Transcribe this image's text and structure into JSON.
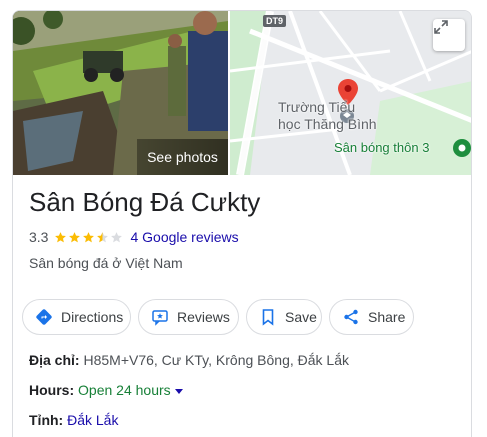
{
  "photo": {
    "see_photos_label": "See photos"
  },
  "map": {
    "road_label": "DT9",
    "school_label_line1": "Trường Tiểu",
    "school_label_line2": "học Thăng Bình",
    "field_label": "Sân bóng thôn 3"
  },
  "place": {
    "title": "Sân Bóng Đá Cưkty",
    "rating": "3.3",
    "stars_filled": 3.3,
    "stars_total": 5,
    "reviews_link": "4 Google reviews",
    "category": "Sân bóng đá ở Việt Nam"
  },
  "actions": {
    "directions": "Directions",
    "reviews": "Reviews",
    "save": "Save",
    "share": "Share"
  },
  "details": {
    "address_label": "Địa chỉ:",
    "address_value": "H85M+V76, Cư KTy, Krông Bông, Đắk Lắk",
    "hours_label": "Hours:",
    "hours_value": "Open 24 hours",
    "province_label": "Tỉnh:",
    "province_value": "Đắk Lắk"
  },
  "colors": {
    "link": "#1a0dab",
    "open_green": "#188038",
    "star": "#fbbc04",
    "pin": "#ea4335",
    "accent_blue": "#1a73e8"
  }
}
